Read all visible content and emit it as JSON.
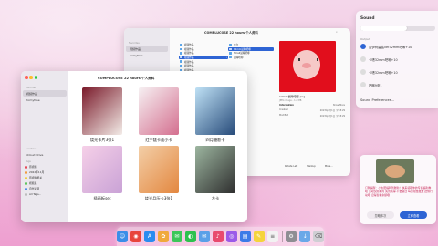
{
  "back_window": {
    "title": "COMPLUCOSE 22 hours 个人资料",
    "sidebar": {
      "heading": "Favorites",
      "items": [
        "视频作品",
        "hcmyfase"
      ]
    },
    "col1": [
      {
        "label": "视频作品"
      },
      {
        "label": "视频作品"
      },
      {
        "label": "视频作品"
      },
      {
        "label": "视频作品"
      },
      {
        "label": "视频作品"
      },
      {
        "label": "视频作品"
      },
      {
        "label": "视频作品"
      }
    ],
    "col2": [
      {
        "label": "方卡"
      },
      {
        "label": "12mm鼠瞳吧唧"
      },
      {
        "label": "Small鼠瞳吧唧"
      },
      {
        "label": "鼠瞳吧唧"
      }
    ],
    "preview": {
      "filename": "12mm鼠瞳吧唧.png",
      "meta": "JPEG image - 1.2 MB",
      "information_label": "Information",
      "information_value": "Show More",
      "rows": [
        {
          "k": "Created",
          "v": "2023年4月1日 下午8:29"
        },
        {
          "k": "Modified",
          "v": "2023年4月1日 下午8:29"
        }
      ],
      "actions": [
        "Rotate Left",
        "Markup",
        "More..."
      ]
    }
  },
  "front_window": {
    "title": "COMPLUCOSE 22 hours 个人资料",
    "sidebar": {
      "heading": "Favorites",
      "items": [
        "视频作品",
        "hcmyfase"
      ],
      "locations_heading": "Locations",
      "locations": [
        "iCloud Drive"
      ],
      "tags_heading": "Tags",
      "tags": [
        {
          "label": "原视频",
          "color": "#e64553"
        },
        {
          "label": "2022年11月",
          "color": "#f0993c"
        },
        {
          "label": "原视频相关",
          "color": "#f0cc3c"
        },
        {
          "label": "视频集",
          "color": "#5ac35a"
        },
        {
          "label": "自然资源",
          "color": "#4b8ee8"
        },
        {
          "label": "All Tags...",
          "color": "#bbbbbb"
        }
      ]
    },
    "grid": [
      {
        "caption": "烧光卡片3张1",
        "colors": [
          "#7a1a2a",
          "#f3ece8"
        ]
      },
      {
        "caption": "红手链卡面小卡",
        "colors": [
          "#f6f0f2",
          "#d46f8f"
        ]
      },
      {
        "caption": "四月摄影卡",
        "colors": [
          "#bfe1f5",
          "#274b7a"
        ]
      },
      {
        "caption": "插画板set",
        "colors": [
          "#f6d0e8",
          "#c9a2d6"
        ]
      },
      {
        "caption": "烧光月历卡3张1",
        "colors": [
          "#f3cfa8",
          "#e3873f"
        ]
      },
      {
        "caption": "方卡",
        "colors": [
          "#9db6a0",
          "#2e2e2e"
        ]
      }
    ]
  },
  "notification_center": {
    "sound_title": "Sound",
    "volume": 0.62,
    "output_label": "Output",
    "devices": [
      {
        "label": "金伊柯留铭ver32mm吧唧+10",
        "selected": true
      },
      {
        "label": "卡嗒32mm吧唧+10",
        "selected": false
      },
      {
        "label": "卡嗒32mm吧唧+10",
        "selected": false
      },
      {
        "label": "吧唧9张1",
        "selected": false
      }
    ],
    "prefs_label": "Sound Preferences...",
    "card": {
      "message": "订购提醒：小太阳福利到账啦！快来领取你的专属福利券吧 活动仅限本周 先到先得 不要错过 每日限量发放 赶快行动吧 记得查看余额哦",
      "dismiss_label": "忽略本次",
      "confirm_label": "立即查看"
    }
  },
  "dock": {
    "apps": [
      {
        "name": "finder",
        "color": "#3b8ee8",
        "glyph": "☺"
      },
      {
        "name": "chrome",
        "color": "#e8453c",
        "glyph": "◉"
      },
      {
        "name": "app-store",
        "color": "#2a8cf0",
        "glyph": "A"
      },
      {
        "name": "photos",
        "color": "#f0a93c",
        "glyph": "✿"
      },
      {
        "name": "messages",
        "color": "#3cc75a",
        "glyph": "✉"
      },
      {
        "name": "wechat",
        "color": "#2dc14e",
        "glyph": "◐"
      },
      {
        "name": "mail",
        "color": "#5aa0e8",
        "glyph": "✉"
      },
      {
        "name": "music",
        "color": "#e84a6e",
        "glyph": "♪"
      },
      {
        "name": "podcasts",
        "color": "#9b5ae8",
        "glyph": "◎"
      },
      {
        "name": "keynote",
        "color": "#3c7be8",
        "glyph": "▤"
      },
      {
        "name": "notes",
        "color": "#f5d43c",
        "glyph": "✎"
      },
      {
        "name": "reminders",
        "color": "#f2f2f2",
        "glyph": "≡"
      },
      {
        "name": "settings",
        "color": "#8e8e93",
        "glyph": "⚙"
      },
      {
        "name": "downloads",
        "color": "#6aa8e8",
        "glyph": "↓"
      },
      {
        "name": "trash",
        "color": "#cfcfd4",
        "glyph": "⌫"
      }
    ]
  }
}
